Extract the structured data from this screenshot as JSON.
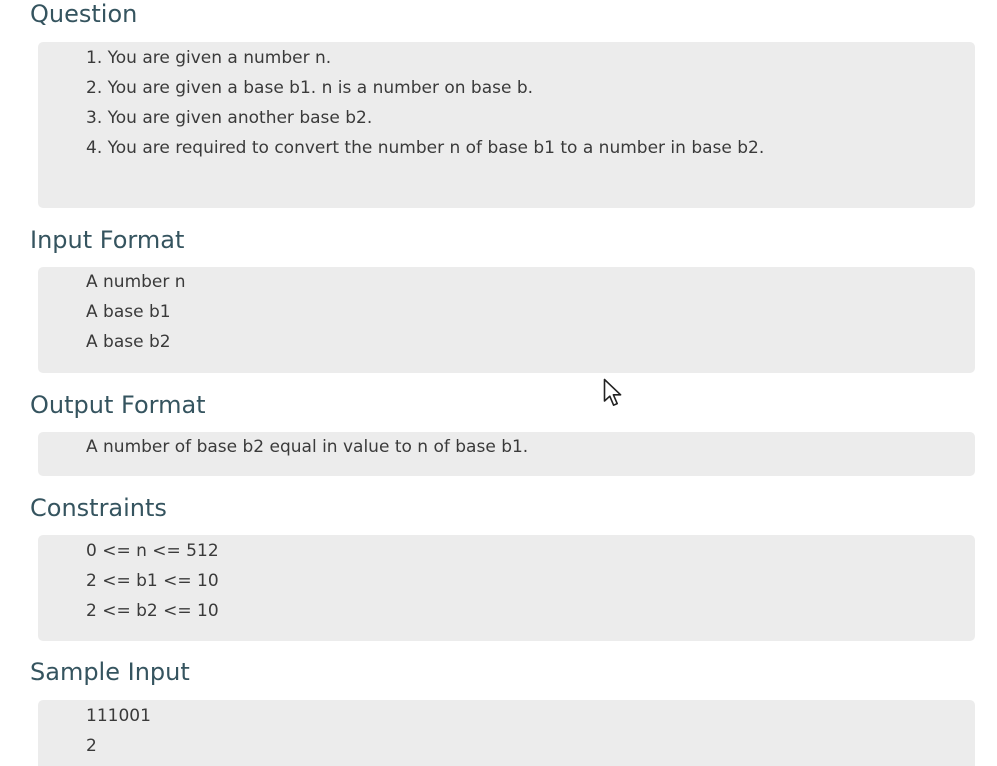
{
  "question": {
    "heading": "Question",
    "lines": [
      "1. You are given a number n.",
      "2. You are given a base b1. n is a number on base b.",
      "3. You are given another base b2.",
      "4. You are required to convert the number n of base b1 to a number in base b2."
    ]
  },
  "input_format": {
    "heading": "Input Format",
    "lines": [
      "A number n",
      "A base b1",
      "A base b2"
    ]
  },
  "output_format": {
    "heading": "Output Format",
    "lines": [
      "A number of base b2 equal in value to n of base b1."
    ]
  },
  "constraints": {
    "heading": "Constraints",
    "lines": [
      "0 <= n <= 512",
      "2 <= b1 <= 10",
      "2 <= b2 <= 10"
    ]
  },
  "sample_input": {
    "heading": "Sample Input",
    "lines": [
      "111001",
      "2"
    ]
  },
  "pointer": {
    "icon": "mouse-pointer-icon"
  }
}
